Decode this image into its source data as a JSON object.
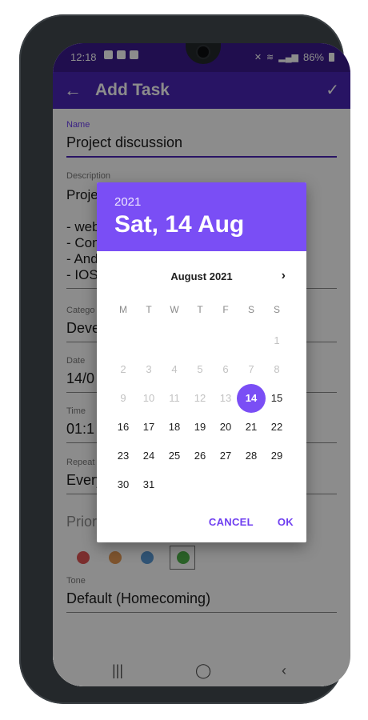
{
  "status": {
    "time": "12:18",
    "battery": "86%"
  },
  "appbar": {
    "title": "Add Task"
  },
  "form": {
    "name_label": "Name",
    "name_value": "Project discussion",
    "description_label": "Description",
    "description_lines": [
      "Proje",
      "",
      "- web",
      "- Con",
      "- And",
      "- IOS"
    ],
    "category_label": "Catego",
    "category_value": "Deve",
    "date_label": "Date",
    "date_value": "14/0",
    "time_label": "Time",
    "time_value": "01:1",
    "repeat_label": "Repeat",
    "repeat_value": "Every",
    "priority_label": "Prior",
    "priority_colors": [
      "#e05454",
      "#e59a54",
      "#5a9ad6",
      "#4fb24a"
    ],
    "tone_label": "Tone",
    "tone_value": "Default (Homecoming)"
  },
  "dialog": {
    "year": "2021",
    "date": "Sat, 14 Aug",
    "month": "August 2021",
    "weekdays": [
      "M",
      "T",
      "W",
      "T",
      "F",
      "S",
      "S"
    ],
    "rows": [
      [
        "",
        "",
        "",
        "",
        "",
        "",
        "1"
      ],
      [
        "2",
        "3",
        "4",
        "5",
        "6",
        "7",
        "8"
      ],
      [
        "9",
        "10",
        "11",
        "12",
        "13",
        "14",
        "15"
      ],
      [
        "16",
        "17",
        "18",
        "19",
        "20",
        "21",
        "22"
      ],
      [
        "23",
        "24",
        "25",
        "26",
        "27",
        "28",
        "29"
      ],
      [
        "30",
        "31",
        "",
        "",
        "",
        "",
        ""
      ]
    ],
    "selected_day": "14",
    "cancel": "CANCEL",
    "ok": "OK"
  }
}
